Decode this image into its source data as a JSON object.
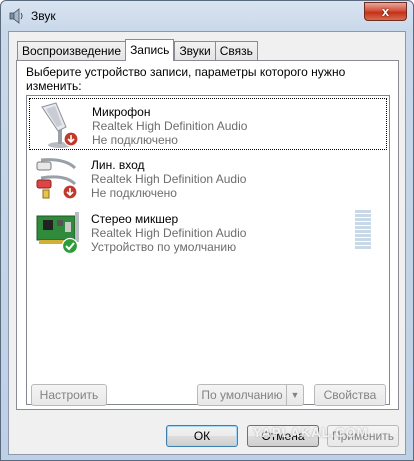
{
  "window": {
    "title": "Звук",
    "close_glyph": "x",
    "icon": "speaker-icon"
  },
  "tabs": [
    {
      "label": "Воспроизведение",
      "active": false
    },
    {
      "label": "Запись",
      "active": true
    },
    {
      "label": "Звуки",
      "active": false
    },
    {
      "label": "Связь",
      "active": false
    }
  ],
  "panel": {
    "instruction": "Выберите устройство записи, параметры которого нужно изменить:"
  },
  "devices": [
    {
      "name": "Микрофон",
      "driver": "Realtek High Definition Audio",
      "status": "Не подключено",
      "icon": "microphone-icon",
      "badge": "disconnected-arrow-icon",
      "selected": true
    },
    {
      "name": "Лин. вход",
      "driver": "Realtek High Definition Audio",
      "status": "Не подключено",
      "icon": "line-in-cable-icon",
      "badge": "disconnected-arrow-icon",
      "selected": false
    },
    {
      "name": "Стерео микшер",
      "driver": "Realtek High Definition Audio",
      "status": "Устройство по умолчанию",
      "icon": "sound-card-icon",
      "badge": "default-check-icon",
      "selected": false
    }
  ],
  "buttons": {
    "configure": "Настроить",
    "set_default": "По умолчанию",
    "properties": "Свойства",
    "ok": "ОК",
    "cancel": "Отмена",
    "apply": "Применить"
  },
  "watermark": "YAPLAKAL.COM",
  "colors": {
    "title_bar": "#c9d8ea",
    "close_button": "#c43217",
    "disabled_text": "#838383",
    "status_text": "#6d6d6d"
  }
}
